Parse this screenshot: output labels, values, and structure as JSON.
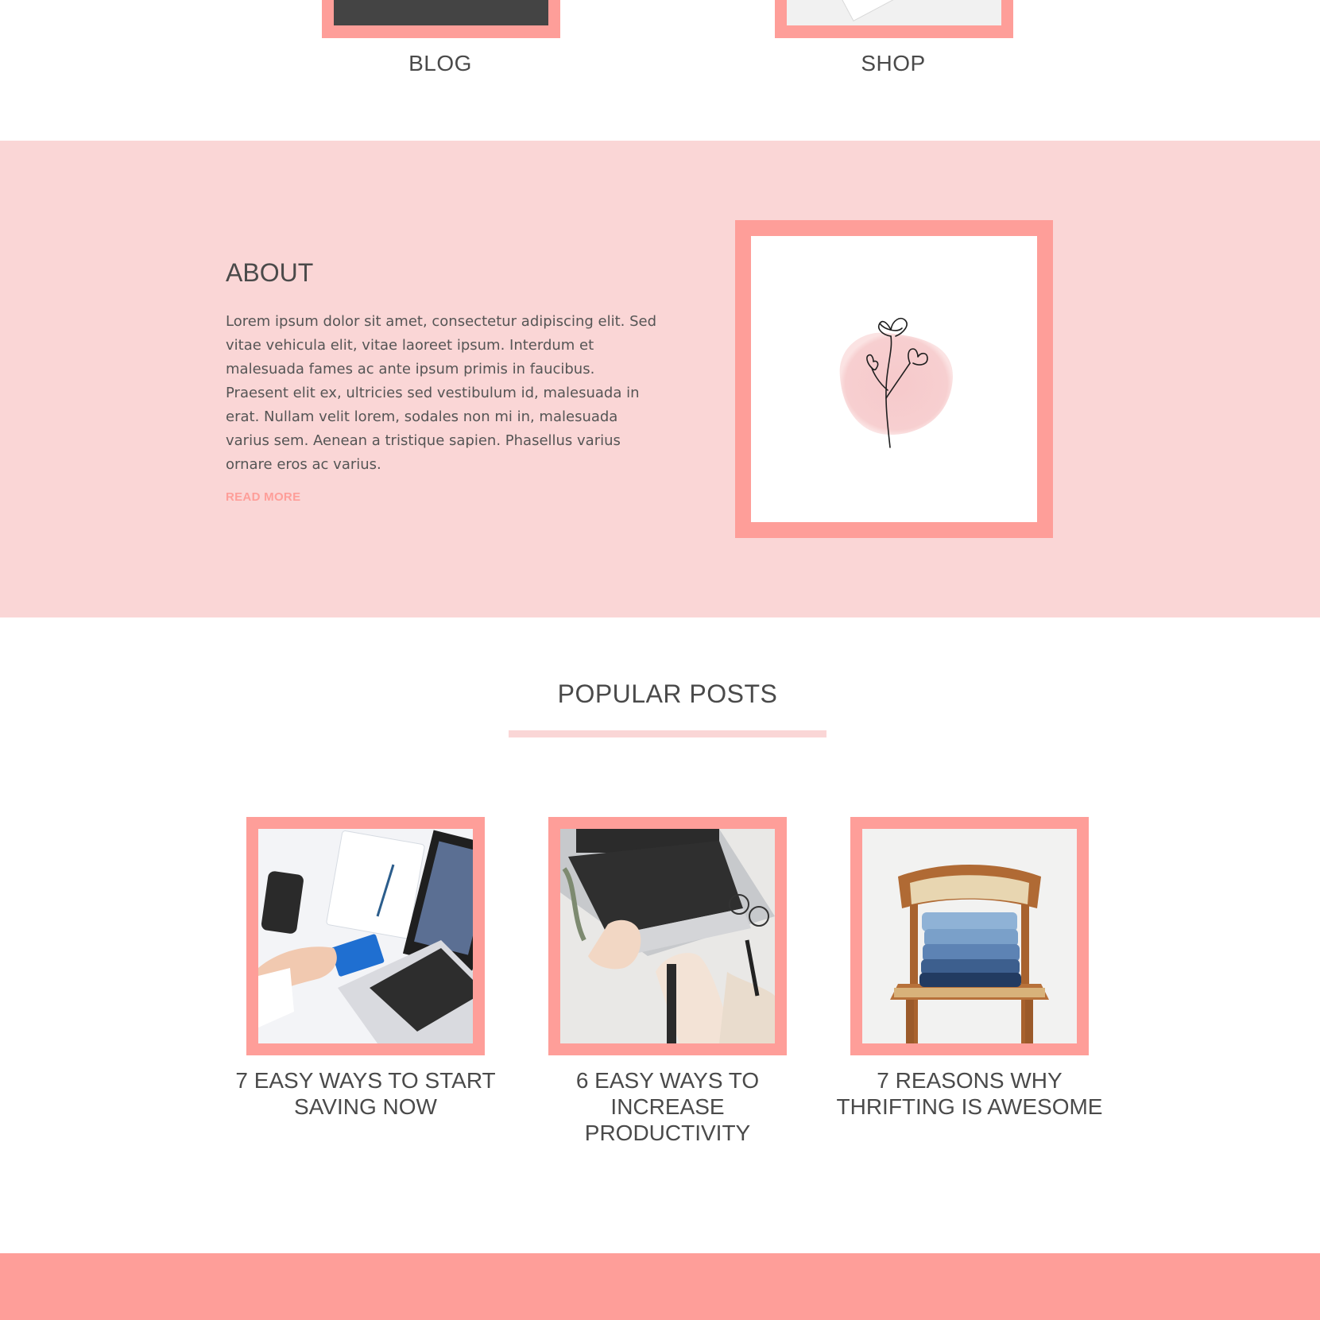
{
  "categories": [
    {
      "label": "BLOG",
      "image": "laptop-photo"
    },
    {
      "label": "SHOP",
      "image": "notepad-photo"
    }
  ],
  "about": {
    "title": "ABOUT",
    "text": "Lorem ipsum dolor sit amet, consectetur adipiscing elit. Sed vitae vehicula elit, vitae laoreet ipsum. Interdum et malesuada fames ac ante ipsum primis in faucibus. Praesent elit ex, ultricies sed vestibulum id, malesuada in erat. Nullam velit lorem, sodales non mi in, malesuada varius sem. Aenean a tristique sapien. Phasellus varius ornare eros ac varius.",
    "read_more": "READ MORE",
    "image": "flower-line-art-illustration"
  },
  "popular": {
    "title": "POPULAR POSTS",
    "posts": [
      {
        "title": "7 EASY WAYS TO START SAVING NOW",
        "image": "credit-card-laptop-photo"
      },
      {
        "title": "6 EASY WAYS TO INCREASE PRODUCTIVITY",
        "image": "typing-laptop-photo"
      },
      {
        "title": "7 REASONS WHY THRIFTING IS AWESOME",
        "image": "denim-on-chair-photo"
      }
    ]
  },
  "colors": {
    "accent": "#fe9e99",
    "band": "#fad6d6",
    "text": "#4a4a4a"
  }
}
